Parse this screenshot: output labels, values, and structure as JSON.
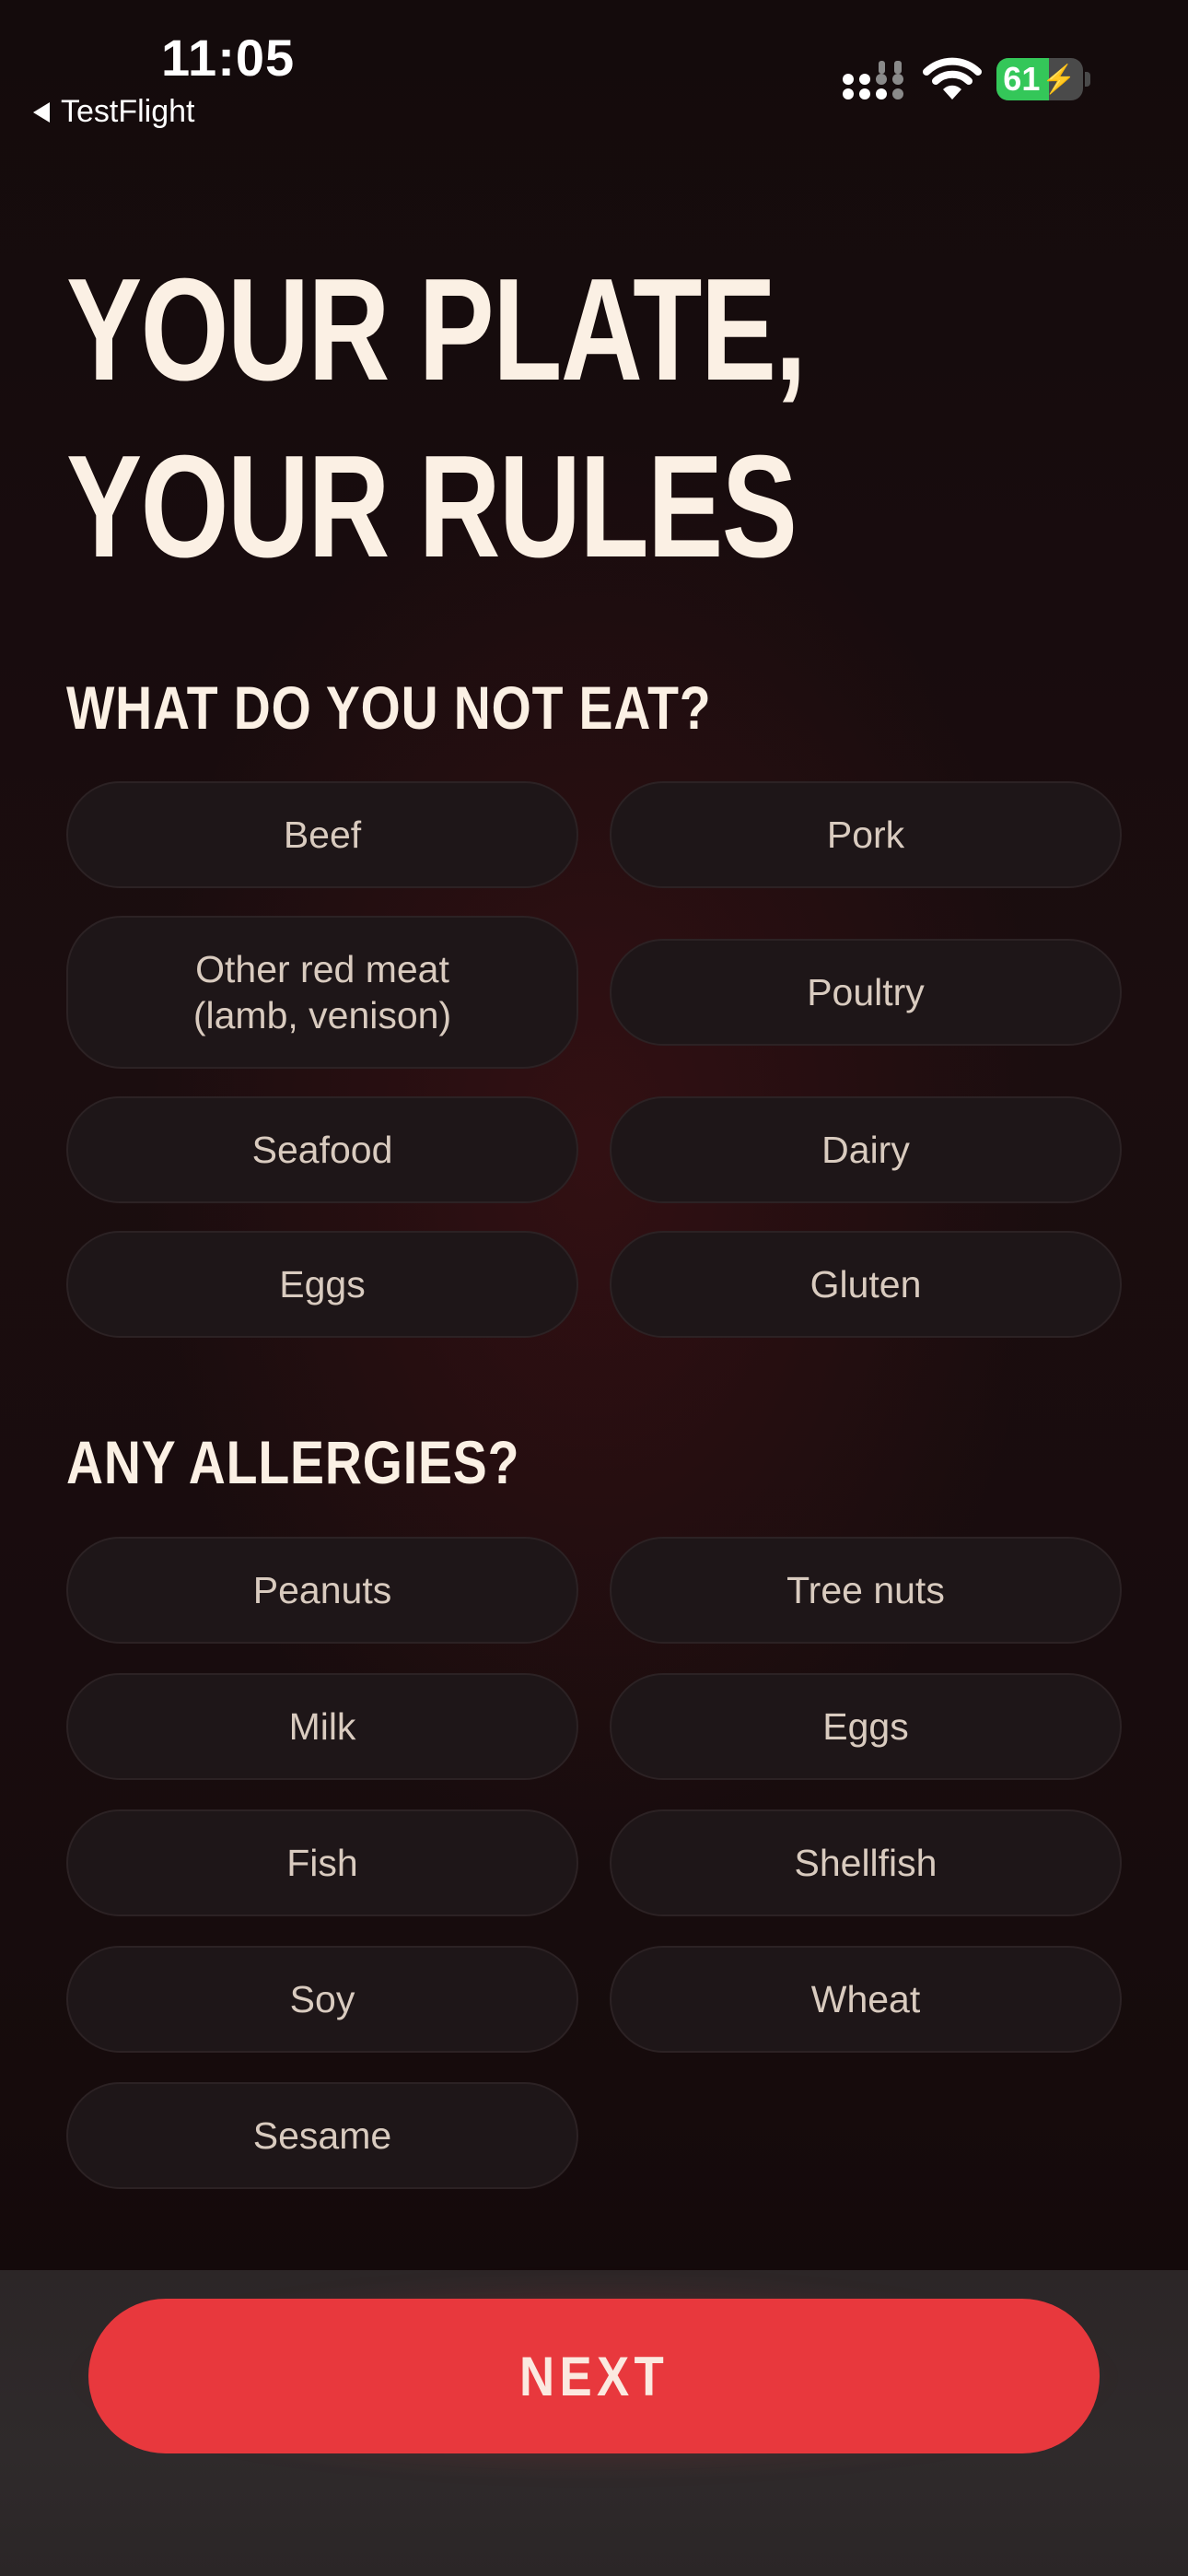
{
  "status_bar": {
    "time": "11:05",
    "back_app": "TestFlight",
    "battery_percent": "61",
    "battery_level": 0.61,
    "icons": [
      "cellular-signal-icon",
      "wifi-icon",
      "battery-charging-icon",
      "back-triangle-icon"
    ]
  },
  "title": {
    "line1": "YOUR PLATE,",
    "line2": "YOUR RULES"
  },
  "diet_section": {
    "heading": "WHAT DO YOU NOT EAT?",
    "options": [
      "Beef",
      "Pork",
      "Other red meat\n(lamb, venison)",
      "Poultry",
      "Seafood",
      "Dairy",
      "Eggs",
      "Gluten"
    ]
  },
  "allergy_section": {
    "heading": "ANY ALLERGIES?",
    "options": [
      "Peanuts",
      "Tree nuts",
      "Milk",
      "Eggs",
      "Fish",
      "Shellfish",
      "Soy",
      "Wheat",
      "Sesame"
    ]
  },
  "footer": {
    "next_label": "NEXT"
  },
  "colors": {
    "background": "#170c0d",
    "title_text": "#fbf0e4",
    "chip_background": "#1e1618",
    "chip_border": "#2c2224",
    "chip_text": "#d9cbbf",
    "accent": "#e8383d",
    "battery_green": "#34c759"
  }
}
